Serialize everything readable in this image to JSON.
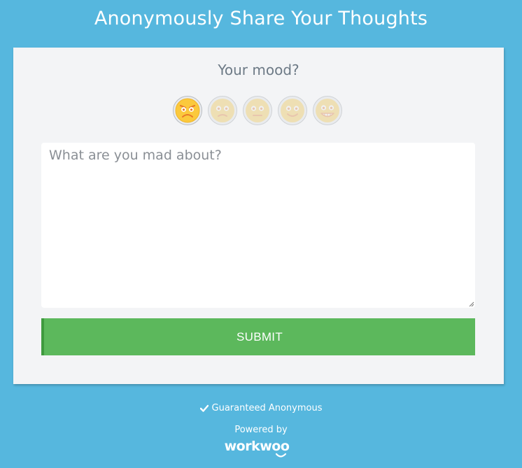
{
  "header": {
    "title": "Anonymously Share Your Thoughts"
  },
  "form": {
    "mood_question": "Your mood?",
    "moods": [
      {
        "name": "mad",
        "selected": true
      },
      {
        "name": "sad",
        "selected": false
      },
      {
        "name": "neutral",
        "selected": false
      },
      {
        "name": "happy",
        "selected": false
      },
      {
        "name": "very-happy",
        "selected": false
      }
    ],
    "comment_value": "",
    "comment_placeholder": "What are you mad about?",
    "submit_label": "SUBMIT"
  },
  "footer": {
    "guarantee_text": "Guaranteed Anonymous",
    "powered_by": "Powered by",
    "brand": "workwoo"
  },
  "colors": {
    "background": "#56b7de",
    "card": "#f3f4f6",
    "submit": "#5cb85c",
    "mood_face": "#fbc93d"
  }
}
